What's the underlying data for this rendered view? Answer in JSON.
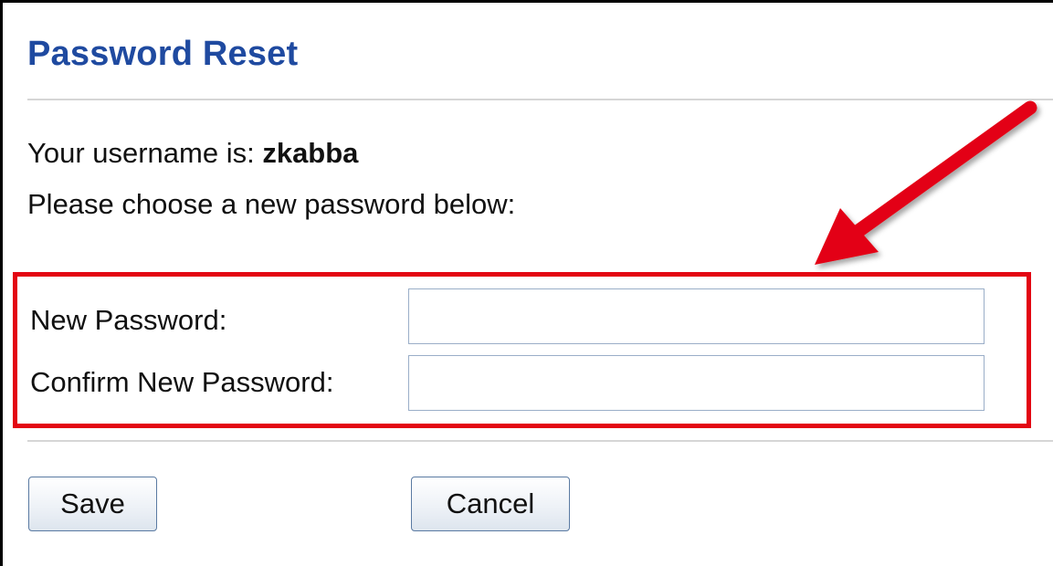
{
  "page": {
    "title": "Password Reset",
    "username_prefix": "Your username is: ",
    "username": "zkabba",
    "instructions": "Please choose a new password below:"
  },
  "form": {
    "new_password_label": "New Password:",
    "new_password_value": "",
    "confirm_password_label": "Confirm New Password:",
    "confirm_password_value": ""
  },
  "buttons": {
    "save_label": "Save",
    "cancel_label": "Cancel"
  },
  "annotation": {
    "highlight_color": "#e30613",
    "arrow_color": "#e30613"
  },
  "colors": {
    "title": "#1f4aa0",
    "input_border": "#9aaec8",
    "button_border": "#5a7aa2"
  }
}
